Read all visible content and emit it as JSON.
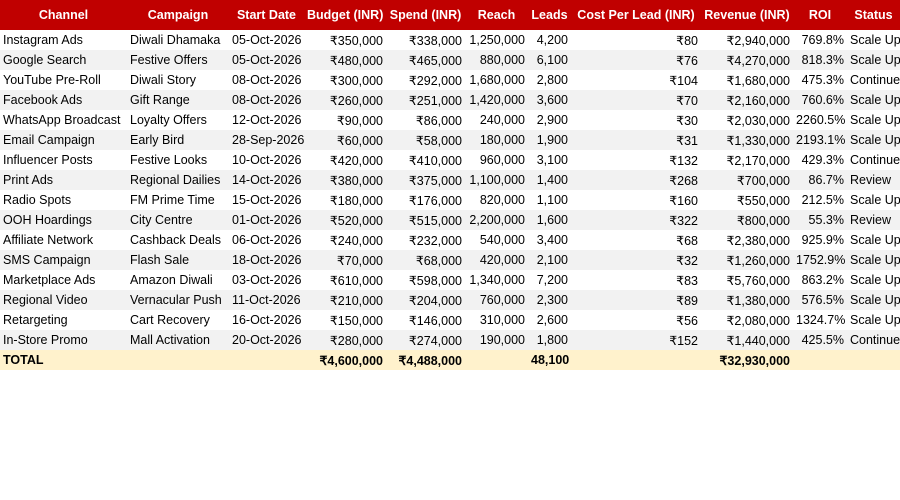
{
  "headers": [
    "Channel",
    "Campaign",
    "Start Date",
    "Budget (INR)",
    "Spend (INR)",
    "Reach",
    "Leads",
    "Cost Per Lead (INR)",
    "Revenue (INR)",
    "ROI",
    "Status"
  ],
  "rows": [
    [
      "Instagram Ads",
      "Diwali Dhamaka",
      "05-Oct-2026",
      "₹350,000",
      "₹338,000",
      "1,250,000",
      "4,200",
      "₹80",
      "₹2,940,000",
      "769.8%",
      "Scale Up"
    ],
    [
      "Google Search",
      "Festive Offers",
      "05-Oct-2026",
      "₹480,000",
      "₹465,000",
      "880,000",
      "6,100",
      "₹76",
      "₹4,270,000",
      "818.3%",
      "Scale Up"
    ],
    [
      "YouTube Pre-Roll",
      "Diwali Story",
      "08-Oct-2026",
      "₹300,000",
      "₹292,000",
      "1,680,000",
      "2,800",
      "₹104",
      "₹1,680,000",
      "475.3%",
      "Continue"
    ],
    [
      "Facebook Ads",
      "Gift Range",
      "08-Oct-2026",
      "₹260,000",
      "₹251,000",
      "1,420,000",
      "3,600",
      "₹70",
      "₹2,160,000",
      "760.6%",
      "Scale Up"
    ],
    [
      "WhatsApp Broadcast",
      "Loyalty Offers",
      "12-Oct-2026",
      "₹90,000",
      "₹86,000",
      "240,000",
      "2,900",
      "₹30",
      "₹2,030,000",
      "2260.5%",
      "Scale Up"
    ],
    [
      "Email Campaign",
      "Early Bird",
      "28-Sep-2026",
      "₹60,000",
      "₹58,000",
      "180,000",
      "1,900",
      "₹31",
      "₹1,330,000",
      "2193.1%",
      "Scale Up"
    ],
    [
      "Influencer Posts",
      "Festive Looks",
      "10-Oct-2026",
      "₹420,000",
      "₹410,000",
      "960,000",
      "3,100",
      "₹132",
      "₹2,170,000",
      "429.3%",
      "Continue"
    ],
    [
      "Print Ads",
      "Regional Dailies",
      "14-Oct-2026",
      "₹380,000",
      "₹375,000",
      "1,100,000",
      "1,400",
      "₹268",
      "₹700,000",
      "86.7%",
      "Review"
    ],
    [
      "Radio Spots",
      "FM Prime Time",
      "15-Oct-2026",
      "₹180,000",
      "₹176,000",
      "820,000",
      "1,100",
      "₹160",
      "₹550,000",
      "212.5%",
      "Scale Up"
    ],
    [
      "OOH Hoardings",
      "City Centre",
      "01-Oct-2026",
      "₹520,000",
      "₹515,000",
      "2,200,000",
      "1,600",
      "₹322",
      "₹800,000",
      "55.3%",
      "Review"
    ],
    [
      "Affiliate Network",
      "Cashback Deals",
      "06-Oct-2026",
      "₹240,000",
      "₹232,000",
      "540,000",
      "3,400",
      "₹68",
      "₹2,380,000",
      "925.9%",
      "Scale Up"
    ],
    [
      "SMS Campaign",
      "Flash Sale",
      "18-Oct-2026",
      "₹70,000",
      "₹68,000",
      "420,000",
      "2,100",
      "₹32",
      "₹1,260,000",
      "1752.9%",
      "Scale Up"
    ],
    [
      "Marketplace Ads",
      "Amazon Diwali",
      "03-Oct-2026",
      "₹610,000",
      "₹598,000",
      "1,340,000",
      "7,200",
      "₹83",
      "₹5,760,000",
      "863.2%",
      "Scale Up"
    ],
    [
      "Regional Video",
      "Vernacular Push",
      "11-Oct-2026",
      "₹210,000",
      "₹204,000",
      "760,000",
      "2,300",
      "₹89",
      "₹1,380,000",
      "576.5%",
      "Scale Up"
    ],
    [
      "Retargeting",
      "Cart Recovery",
      "16-Oct-2026",
      "₹150,000",
      "₹146,000",
      "310,000",
      "2,600",
      "₹56",
      "₹2,080,000",
      "1324.7%",
      "Scale Up"
    ],
    [
      "In-Store Promo",
      "Mall Activation",
      "20-Oct-2026",
      "₹280,000",
      "₹274,000",
      "190,000",
      "1,800",
      "₹152",
      "₹1,440,000",
      "425.5%",
      "Continue"
    ]
  ],
  "total": [
    "TOTAL",
    "",
    "",
    "₹4,600,000",
    "₹4,488,000",
    "",
    "48,100",
    "",
    "₹32,930,000",
    "",
    ""
  ],
  "colors": {
    "header_bg": "#c00000",
    "header_text": "#ffffff",
    "total_bg": "#fff2cc",
    "alt_row_bg": "#f2f2f2"
  }
}
